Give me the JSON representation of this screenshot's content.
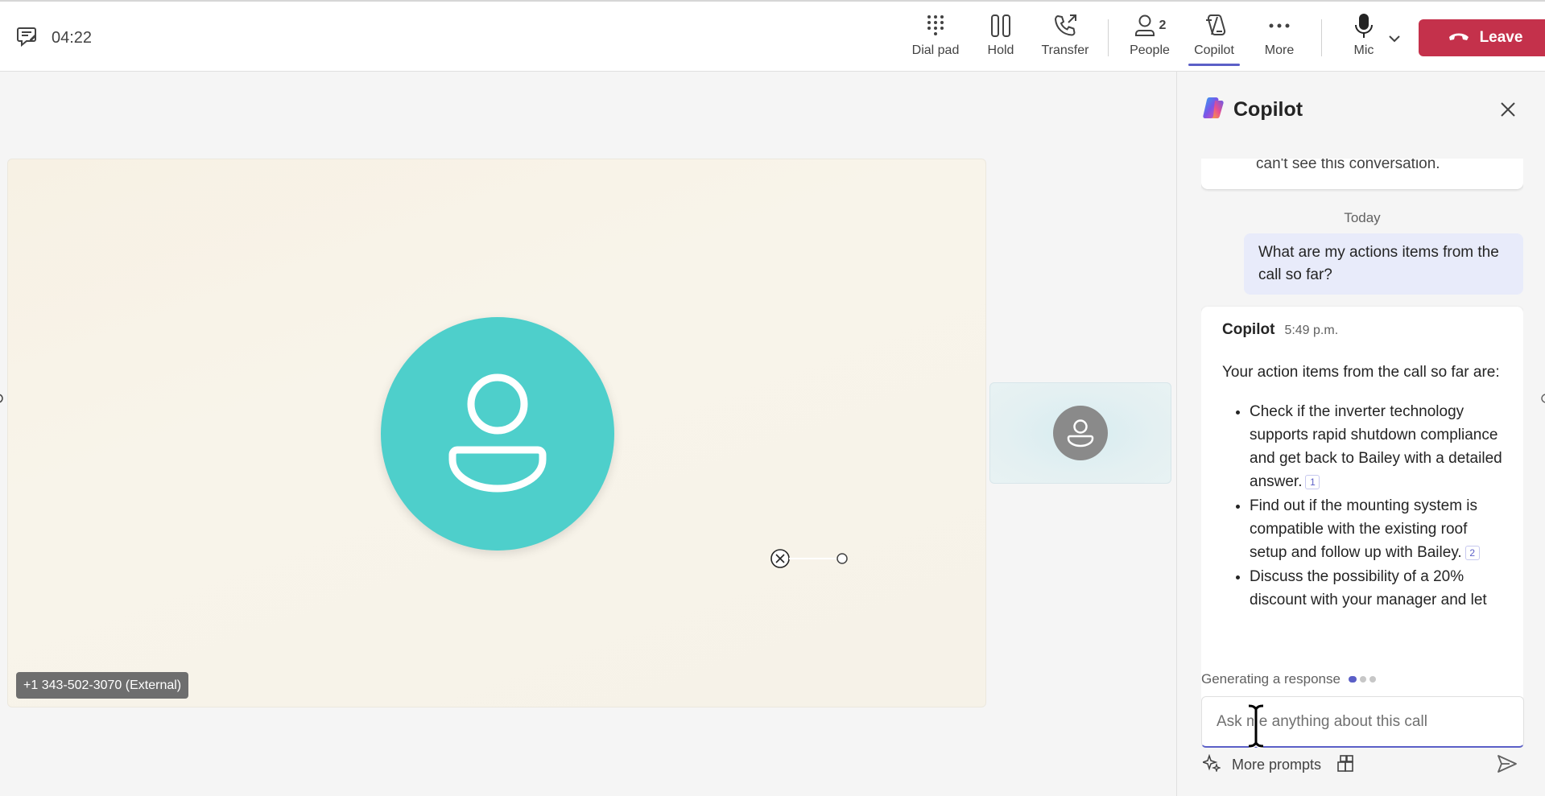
{
  "topbar": {
    "timer": "04:22",
    "buttons": {
      "dialpad": "Dial pad",
      "hold": "Hold",
      "transfer": "Transfer",
      "people": "People",
      "people_count": "2",
      "copilot": "Copilot",
      "more": "More",
      "mic": "Mic"
    },
    "leave_label": "Leave"
  },
  "stage": {
    "participant_label": "+1 343-502-3070 (External)"
  },
  "copilot": {
    "title": "Copilot",
    "prior_message_tail": "can't see this conversation.",
    "day_separator": "Today",
    "user_message": "What are my actions items from the call so far?",
    "response": {
      "sender": "Copilot",
      "time": "5:49 p.m.",
      "intro": "Your action items from the call so far are:",
      "items": [
        {
          "text": "Check if the inverter technology supports rapid shutdown compliance and get back to Bailey with a detailed answer.",
          "ref": "1"
        },
        {
          "text": "Find out if the mounting system is compatible with the existing roof setup and follow up with Bailey.",
          "ref": "2"
        },
        {
          "text": "Discuss the possibility of a 20% discount with your manager and let",
          "ref": ""
        }
      ]
    },
    "status": "Generating a response",
    "input_placeholder": "Ask me anything about this call",
    "more_prompts": "More prompts"
  },
  "colors": {
    "accent": "#5b5fc7",
    "leave": "#c4314b",
    "avatar_teal": "#4ecfcb"
  }
}
